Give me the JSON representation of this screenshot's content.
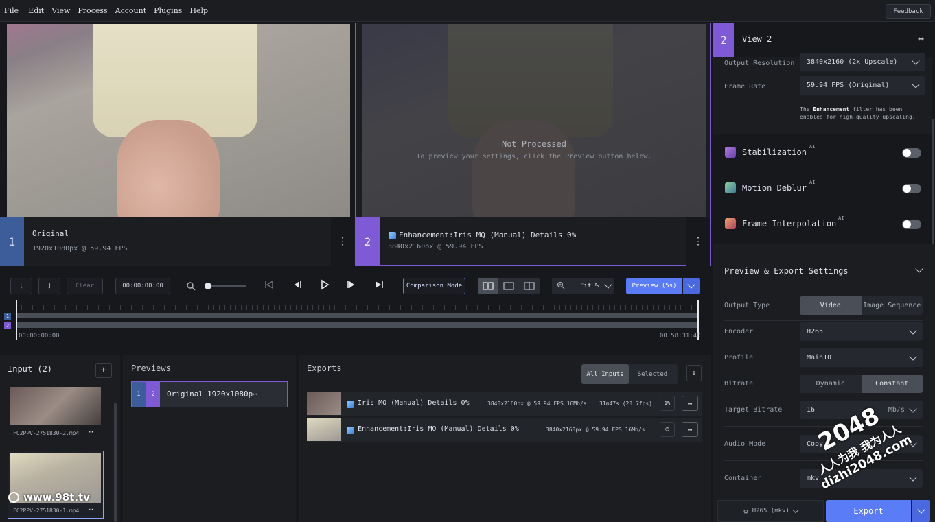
{
  "menu": [
    "File",
    "Edit",
    "View",
    "Process",
    "Account",
    "Plugins",
    "Help"
  ],
  "feedback": "Feedback",
  "views": {
    "left": {
      "number": "1",
      "title": "Original",
      "info": "1920x1080px @ 59.94 FPS"
    },
    "right": {
      "number": "2",
      "title": "Enhancement:Iris MQ (Manual) Details 0%",
      "info": "3840x2160px @ 59.94 FPS",
      "status_title": "Not Processed",
      "status_text": "To preview your settings, click the Preview button below."
    }
  },
  "controls": {
    "mark_in": "[",
    "mark_out": "]",
    "clear": "Clear",
    "timecode": "00:00:00:00",
    "comparison": "Comparison Mode",
    "zoom": "Fit %",
    "preview": "Preview (5s)"
  },
  "timeline": {
    "start": "00:00:00:00",
    "end": "00:58:31:40",
    "tracks": [
      "1",
      "2"
    ]
  },
  "input": {
    "title": "Input (2)",
    "files": [
      {
        "name": "FC2PPV-2751830-2.mp4"
      },
      {
        "name": "FC2PPV-2751830-1.mp4"
      }
    ]
  },
  "previews": {
    "title": "Previews",
    "item": {
      "n1": "1",
      "n2": "2",
      "label": "Original",
      "res": "1920x1080p⋯"
    }
  },
  "exports": {
    "title": "Exports",
    "tabs": [
      "All Inputs",
      "Selected"
    ],
    "rows": [
      {
        "name": "Iris MQ (Manual) Details 0%",
        "spec": "3840x2160px @ 59.94 FPS 16Mb/s",
        "time": "31m47s (20.7fps)",
        "pct": "1%",
        "progress": 0.01
      },
      {
        "name": "Enhancement:Iris MQ (Manual) Details 0%",
        "spec": "3840x2160px @ 59.94 FPS 16Mb/s",
        "time": "",
        "pct": ""
      }
    ]
  },
  "panel": {
    "view_number": "2",
    "view_title": "View 2",
    "output_resolution_label": "Output Resolution",
    "output_resolution": "3840x2160 (2x Upscale)",
    "frame_rate_label": "Frame Rate",
    "frame_rate": "59.94 FPS (Original)",
    "note_pre": "The ",
    "note_bold": "Enhancement",
    "note_post": " filter has been enabled for high-quality upscaling.",
    "filters": [
      {
        "name": "Stabilization",
        "tag": "AI",
        "on": false
      },
      {
        "name": "Motion Deblur",
        "tag": "AI",
        "on": false
      },
      {
        "name": "Frame Interpolation",
        "tag": "AI",
        "on": false
      }
    ],
    "settings_title": "Preview & Export Settings",
    "output_type_label": "Output Type",
    "output_type_options": [
      "Video",
      "Image Sequence"
    ],
    "encoder_label": "Encoder",
    "encoder": "H265",
    "profile_label": "Profile",
    "profile": "Main10",
    "bitrate_label": "Bitrate",
    "bitrate_options": [
      "Dynamic",
      "Constant"
    ],
    "target_bitrate_label": "Target Bitrate",
    "target_bitrate": "16",
    "target_bitrate_unit": "Mb/s",
    "audio_mode_label": "Audio Mode",
    "audio_mode": "Copy",
    "container_label": "Container",
    "container": "mkv",
    "format_summary": "H265 (mkv)",
    "export": "Export"
  },
  "watermarks": {
    "left": "www.98t.tv",
    "right_big": "2048",
    "right_line1": "人人为我 我为人人",
    "right_line2": "dizhi2048.com"
  },
  "colors": {
    "accent_blue": "#5b7cf7",
    "view1": "#3d5c9a",
    "view2": "#7e5ad6",
    "bg": "#16181c"
  }
}
